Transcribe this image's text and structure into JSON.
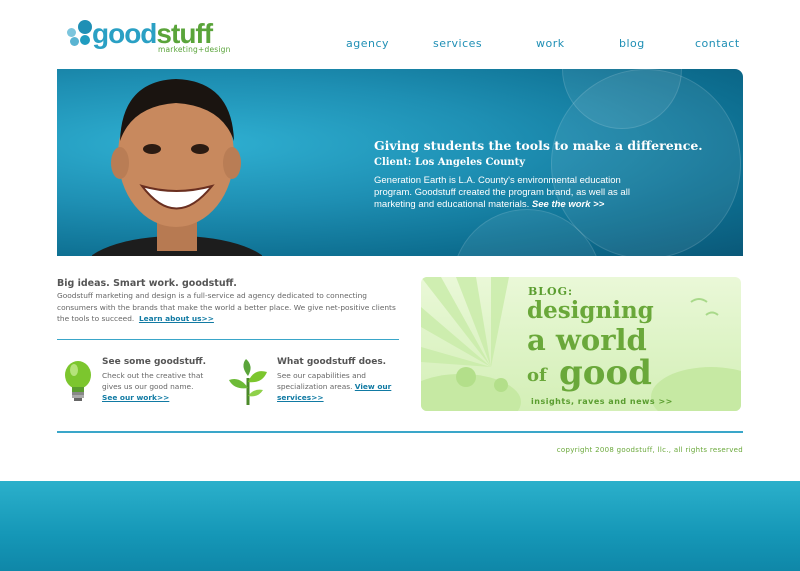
{
  "brand": {
    "name_part1": "good",
    "name_part2": "stuff",
    "tagline": "marketing+design",
    "color_blue": "#2aa0c4",
    "color_green": "#5aa43a"
  },
  "nav": [
    {
      "label": "agency"
    },
    {
      "label": "services"
    },
    {
      "label": "work"
    },
    {
      "label": "blog"
    },
    {
      "label": "contact"
    }
  ],
  "hero": {
    "headline": "Giving students the tools to make a difference.",
    "client": "Client: Los Angeles County",
    "body": "Generation Earth is L.A. County's environmental education program. Goodstuff created the program brand, as well as all marketing and educational materials.",
    "link": "See the work >>"
  },
  "intro": {
    "heading": "Big ideas. Smart work. goodstuff.",
    "body": "Goodstuff marketing and design is a full-service ad agency dedicated to connecting consumers with the brands that make the world a better place. We give net-positive clients the tools to succeed.",
    "link": "Learn about us>>"
  },
  "features": [
    {
      "title": "See some goodstuff.",
      "body": "Check out the creative that gives us our good name.",
      "link": "See our work>>",
      "icon": "lightbulb-icon"
    },
    {
      "title": "What goodstuff does.",
      "body": "See our capabilities and specialization areas.",
      "link": "View our services>>",
      "icon": "plant-icon"
    }
  ],
  "blog": {
    "label": "BLOG:",
    "line1": "designing",
    "line2": "a world",
    "line3a": "of",
    "line3b": "good",
    "cta": "insights, raves and news  >>"
  },
  "copyright": "copyright 2008 goodstuff, llc., all rights reserved"
}
